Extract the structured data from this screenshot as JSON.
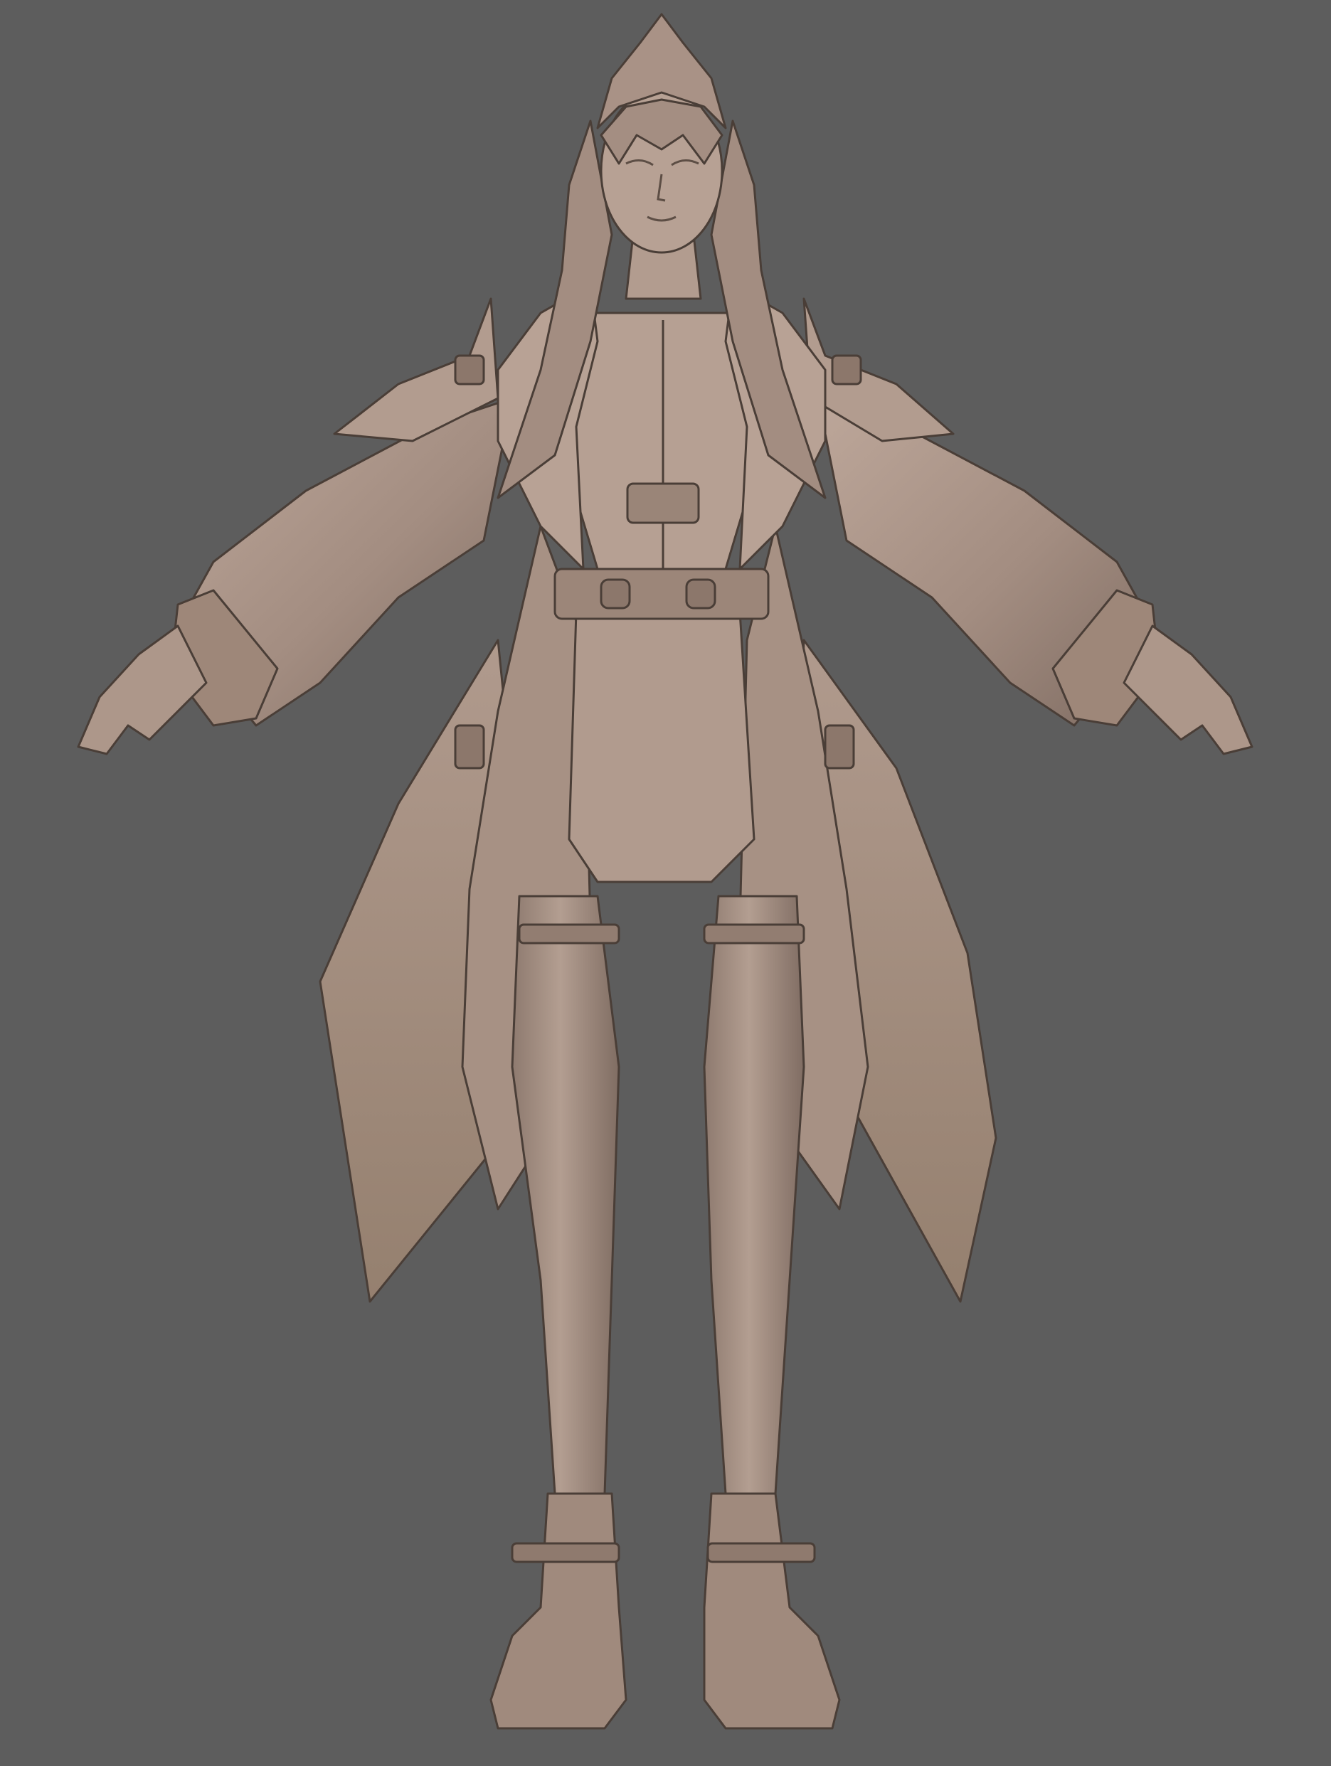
{
  "scene": {
    "background_color": "#5d5d5d",
    "clay_color": "#a38d81",
    "clay_light": "#bba497",
    "clay_dark": "#7c6a60",
    "outline_color": "#4a3e37"
  }
}
